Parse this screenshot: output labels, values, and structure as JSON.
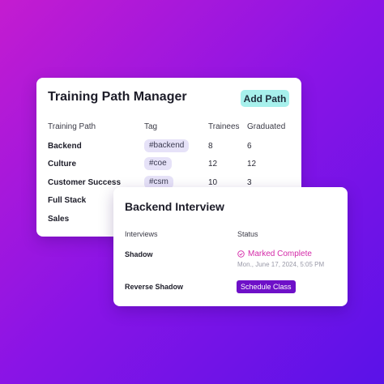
{
  "training_card": {
    "title": "Training Path Manager",
    "add_label": "Add Path",
    "columns": [
      "Training Path",
      "Tag",
      "Trainees",
      "Graduated"
    ],
    "rows": [
      {
        "name": "Backend",
        "tag": "#backend",
        "trainees": "8",
        "graduated": "6"
      },
      {
        "name": "Culture",
        "tag": "#coe",
        "trainees": "12",
        "graduated": "12"
      },
      {
        "name": "Customer Success",
        "tag": "#csm",
        "trainees": "10",
        "graduated": "3"
      },
      {
        "name": "Full Stack"
      },
      {
        "name": "Sales"
      }
    ]
  },
  "interview_card": {
    "title": "Backend Interview",
    "columns": [
      "Interviews",
      "Status"
    ],
    "rows": [
      {
        "name": "Shadow",
        "status": "Marked Complete",
        "date": "Mon., June 17, 2024, 5:05 PM"
      },
      {
        "name": "Reverse Shadow",
        "action": "Schedule Class"
      }
    ]
  },
  "colors": {
    "accent_teal": "#a7f0ec",
    "accent_purple": "#6e10c8",
    "complete_pink": "#d42aa8",
    "background_start": "#c41cd0",
    "background_end": "#5a12e8"
  },
  "icons": {
    "status_complete": "check-circle-icon"
  }
}
